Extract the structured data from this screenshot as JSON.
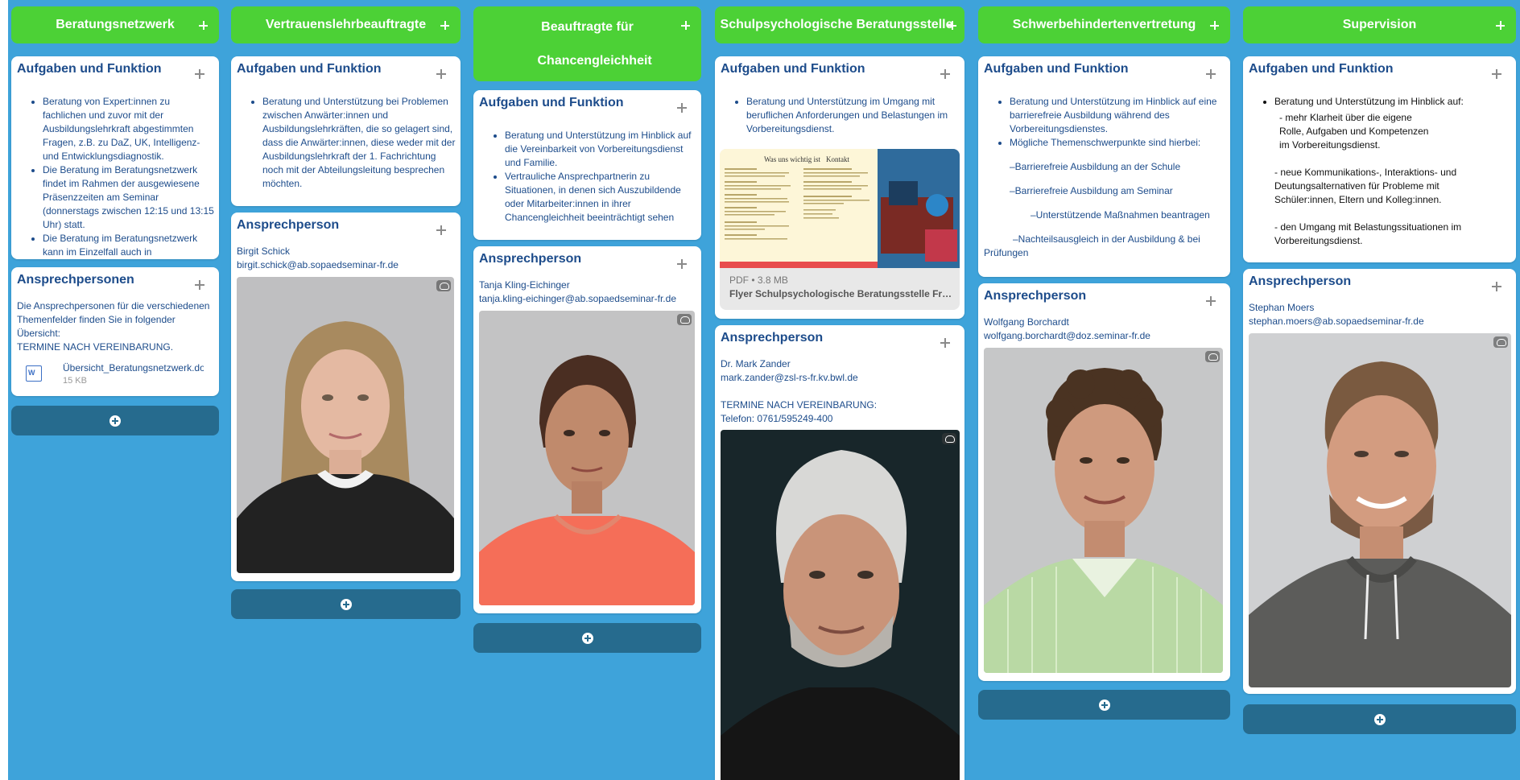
{
  "colors": {
    "background": "#3ea3da",
    "header": "#4cd136",
    "button": "#266b8e",
    "title": "#1d4c8b"
  },
  "columns": [
    {
      "title": "Beratungsnetzwerk",
      "task_title": "Aufgaben und Funktion",
      "bullets": [
        "Beratung von Expert:innen zu fachlichen und zuvor mit der Ausbildungslehrkraft abgestimmten Fragen, z.B. zu DaZ, UK, Intelligenz- und Entwicklungsdiagnostik.",
        "Die Beratung im Beratungsnetzwerk findet im Rahmen der ausgewiesene Präsenzzeiten am Seminar (donnerstags zwischen 12:15 und 13:15 Uhr) statt.",
        "Die Beratung im Beratungsnetzwerk kann im Einzelfall auch in Praxissituationen vor Ort stattfinden."
      ],
      "contact_title": "Ansprechpersonen",
      "contact_text": "Die Ansprechpersonen für die verschiedenen Themenfelder finden Sie in folgender Übersicht:",
      "contact_note": "TERMINE NACH VEREINBARUNG.",
      "file_name": "Übersicht_Beratungsnetzwerk.docx",
      "file_size": "15 KB",
      "file_icon": "word-document-icon"
    },
    {
      "title": "Vertrauenslehrbeauftragte",
      "task_title": "Aufgaben und Funktion",
      "bullets": [
        "Beratung und Unterstützung bei Problemen zwischen Anwärter:innen und Ausbildungslehrkräften, die so gelagert sind, dass die Anwärter:innen, diese weder mit der Ausbildungslehrkraft der 1. Fachrichtung noch mit der Abteilungsleitung besprechen möchten."
      ],
      "contact_title": "Ansprechperson",
      "contact_name": "Birgit Schick",
      "contact_email": "birgit.schick@ab.sopaedseminar-fr.de"
    },
    {
      "title": "Beauftragte für Chancengleichheit",
      "task_title": "Aufgaben und Funktion",
      "bullets": [
        "Beratung und Unterstützung im Hinblick auf die Vereinbarkeit von Vorbereitungsdienst und Familie.",
        "Vertrauliche Ansprechpartnerin zu Situationen, in denen sich Auszubildende oder Mitarbeiter:innen in ihrer Chancengleichheit beeinträchtigt sehen"
      ],
      "contact_title": "Ansprechperson",
      "contact_name": "Tanja Kling-Eichinger",
      "contact_email": "tanja.kling-eichinger@ab.sopaedseminar-fr.de"
    },
    {
      "title": "Schulpsychologische Beratungsstelle",
      "task_title": "Aufgaben und Funktion",
      "bullets": [
        "Beratung und Unterstützung im Umgang mit beruflichen Anforderungen und Belastungen im Vorbereitungsdienst."
      ],
      "pdf_meta": "PDF • 3.8 MB",
      "pdf_name": "Flyer Schulpsychologische Beratungsstelle Freiburg",
      "pdf_col1": "Was uns wichtig ist",
      "pdf_col2": "Kontakt",
      "contact_title": "Ansprechperson",
      "contact_name": "Dr. Mark Zander",
      "contact_email": "mark.zander@zsl-rs-fr.kv.bwl.de",
      "contact_note": "TERMINE NACH VEREINBARUNG:",
      "contact_phone": "Telefon: 0761/595249-400"
    },
    {
      "title": "Schwerbehindertenvertretung",
      "task_title": "Aufgaben und Funktion",
      "bullets": [
        "Beratung und Unterstützung im Hinblick auf eine barrierefreie Ausbildung während des Vorbereitungsdienstes.",
        "Mögliche Themenschwerpunkte sind hierbei:"
      ],
      "topics": [
        "–Barrierefreie Ausbildung an der Schule",
        "–Barrierefreie Ausbildung am Seminar",
        "–Unterstützende Maßnahmen beantragen",
        "–Nachteilsausgleich in der Ausbildung & bei Prüfungen"
      ],
      "contact_title": "Ansprechperson",
      "contact_name": "Wolfgang Borchardt",
      "contact_email": "wolfgang.borchardt@doz.seminar-fr.de"
    },
    {
      "title": "Supervision",
      "task_title": "Aufgaben und Funktion",
      "bullets": [
        "Beratung und Unterstützung im Hinblick auf:"
      ],
      "points": [
        "- mehr Klarheit über die eigene Rolle, Aufgaben und Kompetenzen im Vorbereitungsdienst.",
        "- neue Kommunikations-, Interaktions- und Deutungsalternativen für Probleme mit Schüler:innen, Eltern und Kolleg:innen.",
        "- den Umgang mit Belastungssituationen im Vorbereitungsdienst."
      ],
      "contact_title": "Ansprechperson",
      "contact_name": "Stephan Moers",
      "contact_email": "stephan.moers@ab.sopaedseminar-fr.de"
    }
  ]
}
